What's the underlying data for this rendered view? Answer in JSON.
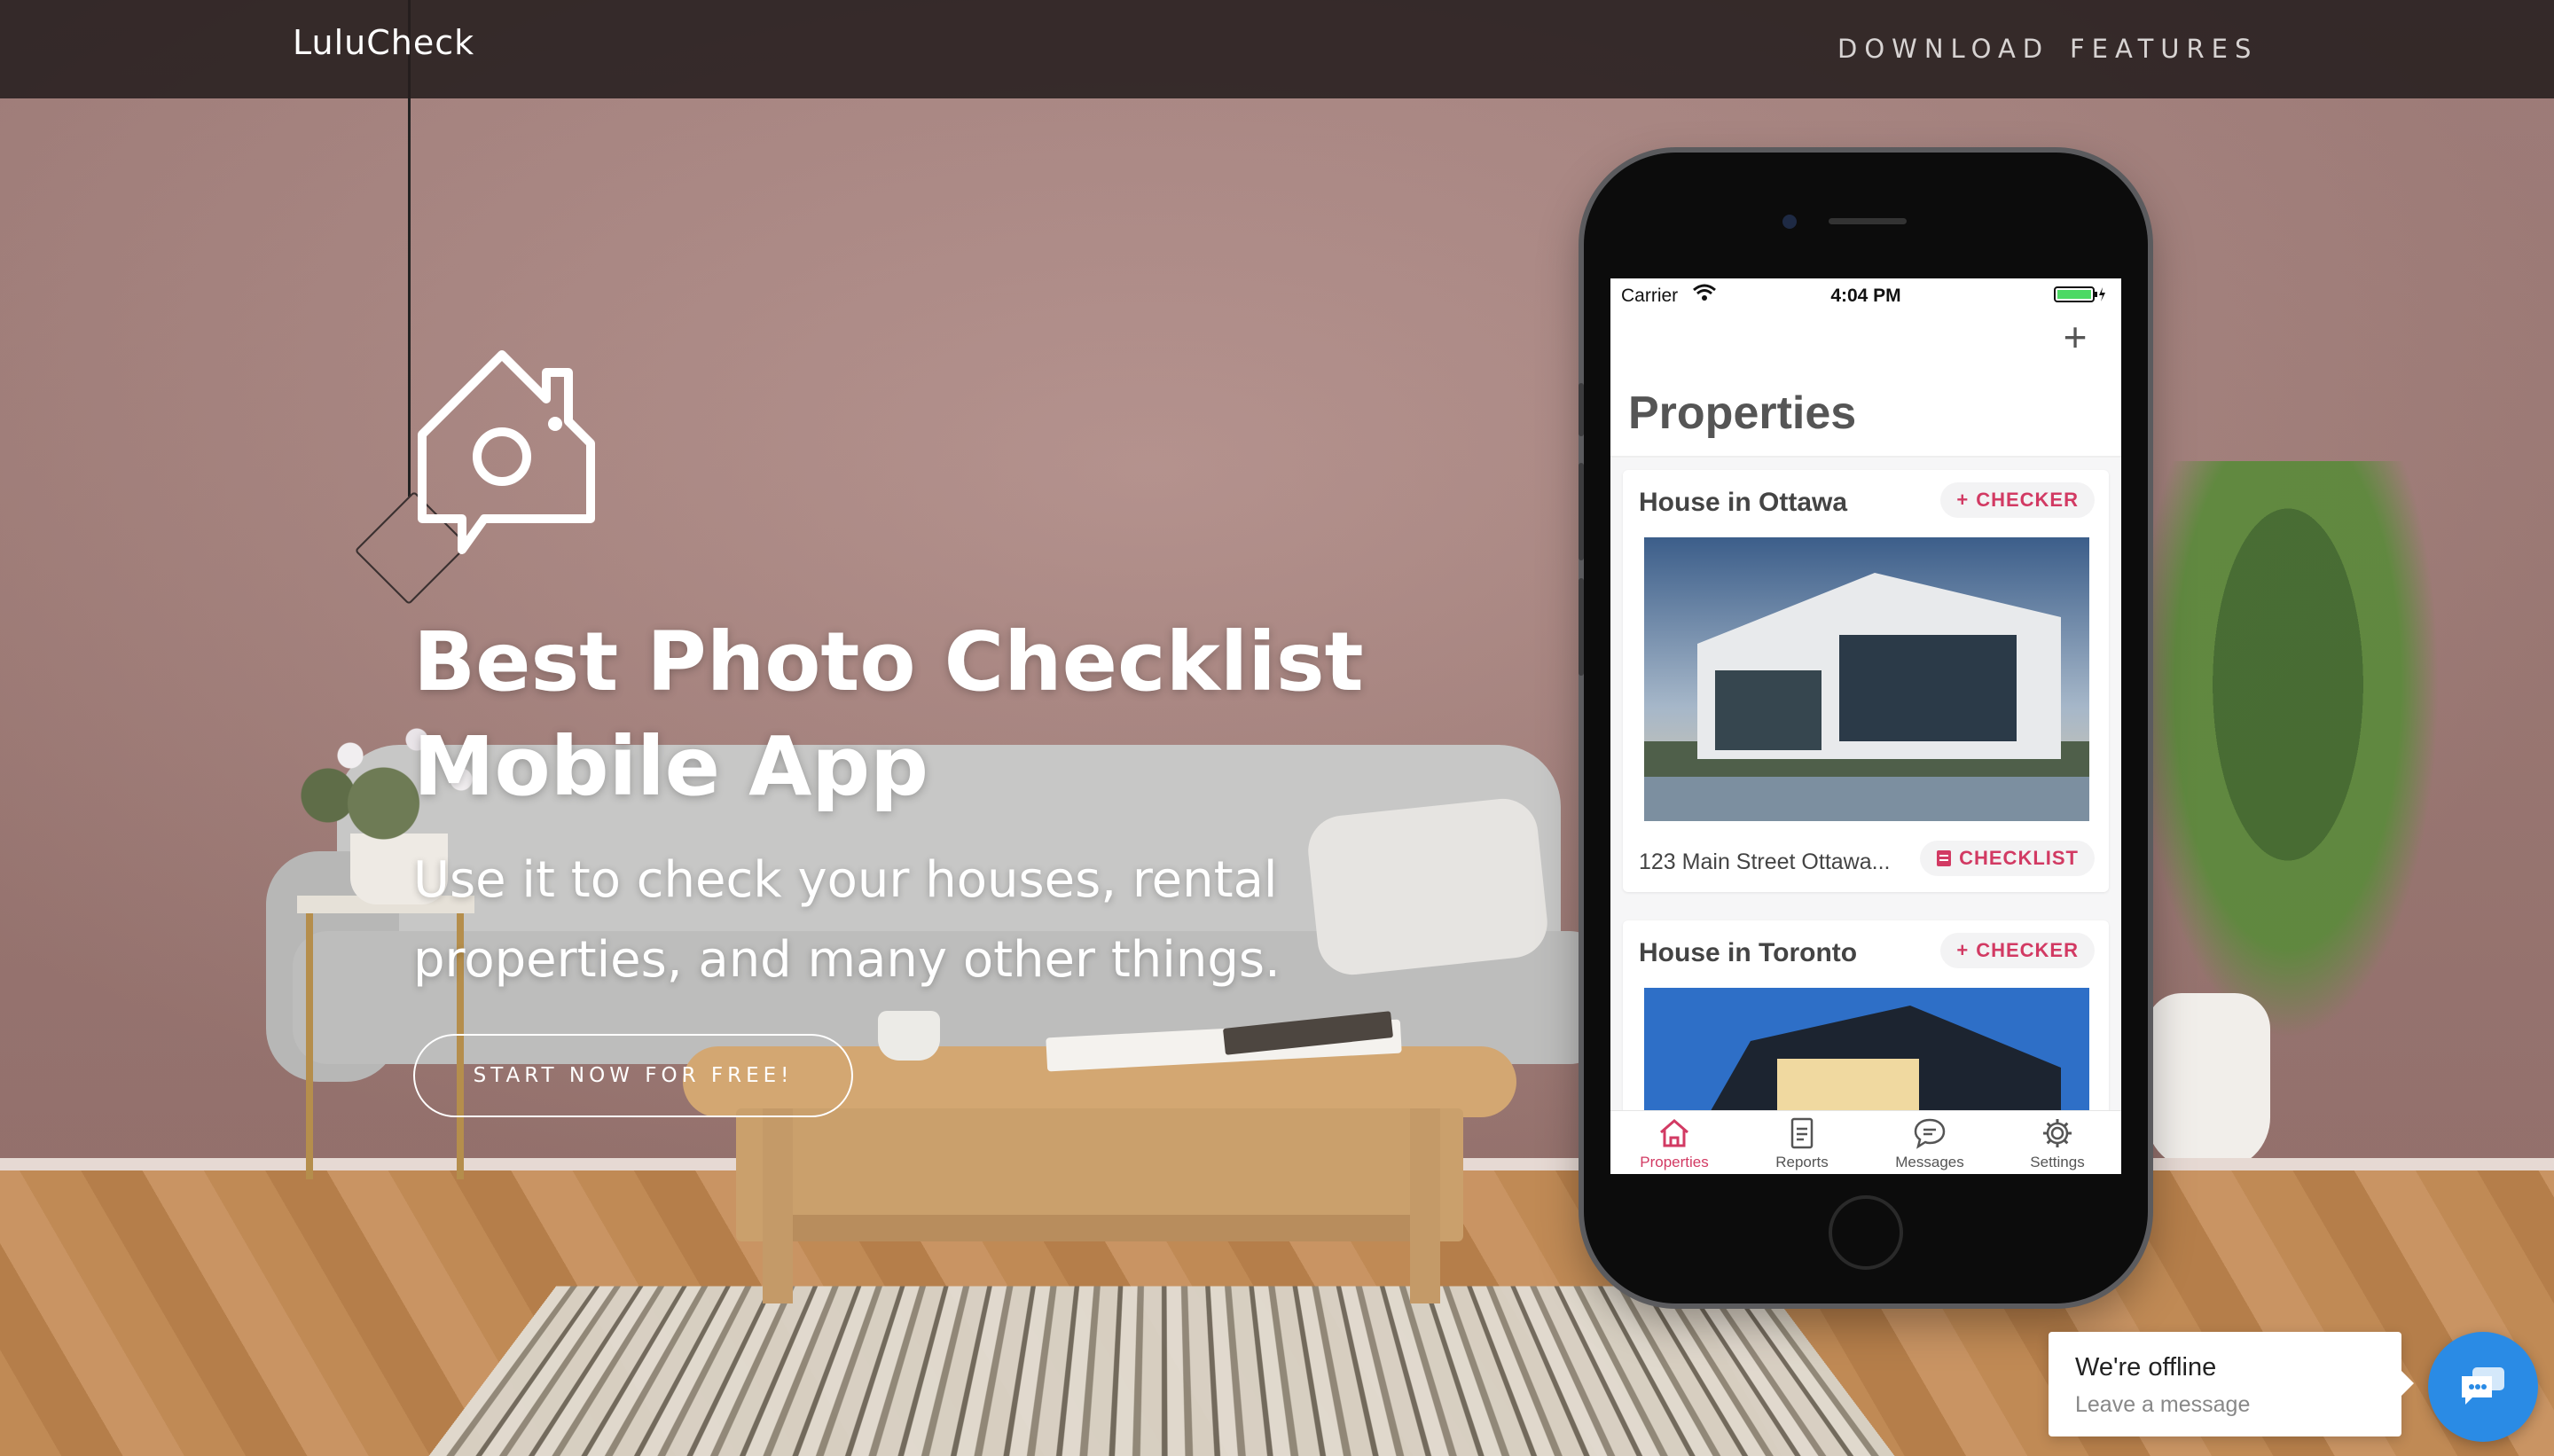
{
  "nav": {
    "brand": "LuluCheck",
    "links": [
      "DOWNLOAD",
      "FEATURES"
    ]
  },
  "hero": {
    "title_line1": "Best Photo Checklist",
    "title_line2": "Mobile App",
    "subtitle_line1": "Use it to check your houses, rental",
    "subtitle_line2": "properties, and many other things.",
    "cta_label": "START NOW FOR FREE!"
  },
  "phone": {
    "status": {
      "carrier": "Carrier",
      "time": "4:04 PM"
    },
    "screen_title": "Properties",
    "properties": [
      {
        "name": "House in Ottawa",
        "checker_label": "CHECKER",
        "address": "123 Main Street Ottawa...",
        "checklist_label": "CHECKLIST"
      },
      {
        "name": "House in Toronto",
        "checker_label": "CHECKER"
      }
    ],
    "tabs": [
      {
        "label": "Properties",
        "icon": "home-icon",
        "active": true
      },
      {
        "label": "Reports",
        "icon": "document-icon",
        "active": false
      },
      {
        "label": "Messages",
        "icon": "chat-bubble-icon",
        "active": false
      },
      {
        "label": "Settings",
        "icon": "gear-icon",
        "active": false
      }
    ],
    "accent_color": "#d23a63"
  },
  "chat": {
    "status": "We're offline",
    "sub": "Leave a message",
    "button_color": "#2a8be5"
  }
}
